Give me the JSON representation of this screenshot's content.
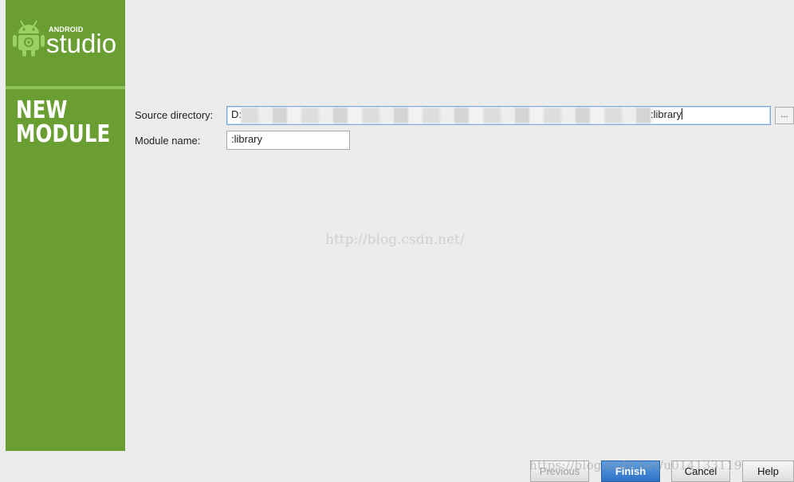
{
  "brand": {
    "small_text": "ANDROID",
    "big_text": "studio",
    "icon": "android-icon"
  },
  "sidebar": {
    "title_line1": "NEW",
    "title_line2": "MODULE"
  },
  "form": {
    "source_directory_label": "Source directory:",
    "source_directory_prefix": "D:",
    "source_directory_suffix": ":library",
    "browse_button_label": "...",
    "module_name_label": "Module name:",
    "module_name_value": ":library"
  },
  "watermark": {
    "center_text": "http://blog.csdn.net/",
    "bottom_text": "https://blog.csdn.net/u014133119"
  },
  "footer": {
    "previous_label": "Previous",
    "finish_label": "Finish",
    "cancel_label": "Cancel",
    "help_label": "Help"
  },
  "colors": {
    "sidebar_green": "#6a9e32",
    "accent_blue": "#2f72c6"
  }
}
